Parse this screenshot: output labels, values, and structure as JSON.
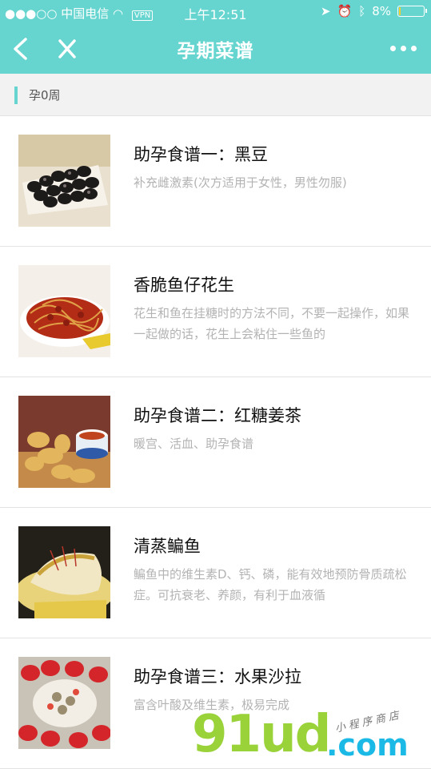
{
  "status_bar": {
    "carrier": "●●●○○ 中国电信",
    "vpn": "VPN",
    "time": "上午12:51",
    "battery": "8%",
    "battery_level": 0.08
  },
  "navbar": {
    "title": "孕期菜谱",
    "back_icon": "chevron-left-icon",
    "close_icon": "close-icon",
    "more_icon": "more-dots-icon"
  },
  "week": {
    "label": "孕0周"
  },
  "recipes": [
    {
      "title": "助孕食谱一：黑豆",
      "desc": "补充雌激素(次方适用于女性，男性勿服)"
    },
    {
      "title": "香脆鱼仔花生",
      "desc": "花生和鱼在挂糖时的方法不同，不要一起操作，如果一起做的话，花生上会粘住一些鱼的"
    },
    {
      "title": "助孕食谱二：红糖姜茶",
      "desc": "暖宫、活血、助孕食谱"
    },
    {
      "title": "清蒸鳊鱼",
      "desc": "鳊鱼中的维生素D、钙、磷，能有效地预防骨质疏松症。可抗衰老、养颜，有利于血液循"
    },
    {
      "title": "助孕食谱三：水果沙拉",
      "desc": "富含叶酸及维生素，极易完成"
    }
  ],
  "watermark": {
    "logo": "91ud",
    "domain": ".com",
    "slogan": "小程序商店"
  }
}
